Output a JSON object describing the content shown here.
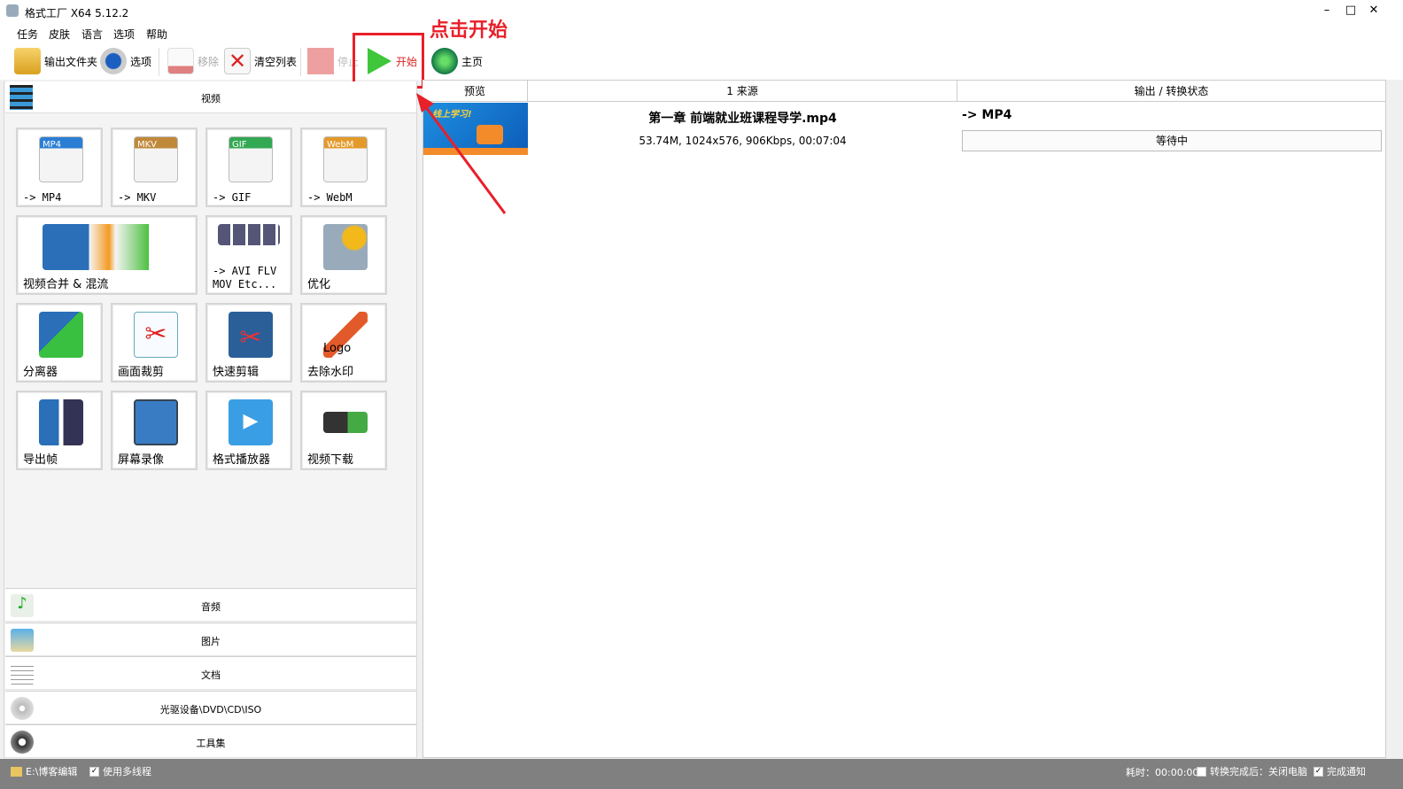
{
  "window": {
    "title": "格式工厂 X64 5.12.2",
    "minimize": "–",
    "maximize": "□",
    "close": "✕"
  },
  "menu": [
    "任务",
    "皮肤",
    "语言",
    "选项",
    "帮助"
  ],
  "toolbar": {
    "output_folder": "输出文件夹",
    "options": "选项",
    "remove": "移除",
    "clear_list": "清空列表",
    "stop": "停止",
    "start": "开始",
    "home": "主页"
  },
  "annotation": {
    "text": "点击开始",
    "color": "#e8202a"
  },
  "left_panel": {
    "video_header": "视频",
    "tiles": [
      {
        "label": "-> MP4",
        "badge": "MP4",
        "mono": true
      },
      {
        "label": "-> MKV",
        "badge": "MKV",
        "mono": true
      },
      {
        "label": "-> GIF",
        "badge": "GIF",
        "mono": true
      },
      {
        "label": "-> WebM",
        "badge": "WebM",
        "mono": true
      },
      {
        "label": "视频合并 & 混流"
      },
      {
        "label": "-> AVI FLV MOV Etc...",
        "mono": true
      },
      {
        "label": "优化"
      },
      {
        "label": "分离器"
      },
      {
        "label": "画面裁剪"
      },
      {
        "label": "快速剪辑"
      },
      {
        "label": "去除水印",
        "badge": "Logo"
      },
      {
        "label": "导出帧"
      },
      {
        "label": "屏幕录像"
      },
      {
        "label": "格式播放器"
      },
      {
        "label": "视频下载"
      }
    ],
    "categories": [
      "音频",
      "图片",
      "文档",
      "光驱设备\\DVD\\CD\\ISO",
      "工具集"
    ]
  },
  "file_list": {
    "headers": [
      "预览",
      "1 来源",
      "输出 / 转换状态"
    ],
    "rows": [
      {
        "name": "第一章 前端就业班课程导学.mp4",
        "info": "53.74M, 1024x576, 906Kbps, 00:07:04",
        "output": "-> MP4",
        "status": "等待中"
      }
    ]
  },
  "status_bar": {
    "folder": "E:\\博客编辑",
    "multithread": "使用多线程",
    "elapsed": "耗时：00:00:00",
    "after": "转换完成后：关闭电脑",
    "notify": "完成通知"
  }
}
